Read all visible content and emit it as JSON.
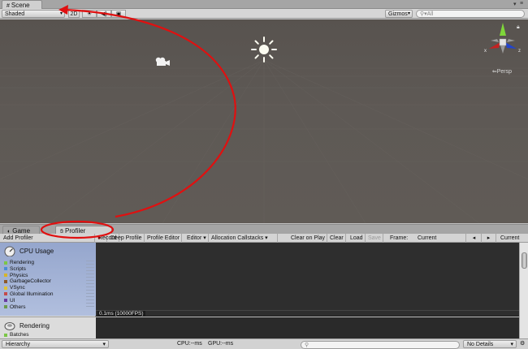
{
  "scene": {
    "tab_label": "Scene",
    "shading_mode": "Shaded",
    "mode_2d_label": "2D",
    "gizmos_label": "Gizmos",
    "search_placeholder": "All",
    "projection_label": "Persp",
    "axis_x": "x",
    "axis_z": "z"
  },
  "bottom_tabs": [
    {
      "label": "Game",
      "icon": "game-controller-icon",
      "active": false
    },
    {
      "label": "Profiler",
      "icon": "profiler-hand-icon",
      "active": true
    }
  ],
  "profiler": {
    "add_profiler_label": "Add Profiler",
    "record_label": "Record",
    "deep_profile_label": "Deep Profile",
    "profile_editor_label": "Profile Editor",
    "editor_label": "Editor",
    "allocation_callstacks_label": "Allocation Callstacks",
    "clear_on_play_label": "Clear on Play",
    "clear_label": "Clear",
    "load_label": "Load",
    "save_label": "Save",
    "frame_label": "Frame:",
    "frame_value": "Current",
    "current_label": "Current",
    "cpu_module": {
      "title": "CPU Usage",
      "legend": [
        {
          "label": "Rendering",
          "color": "#7bc646"
        },
        {
          "label": "Scripts",
          "color": "#4a8bd6"
        },
        {
          "label": "Physics",
          "color": "#d6b52a"
        },
        {
          "label": "GarbageCollector",
          "color": "#8c5a2a"
        },
        {
          "label": "VSync",
          "color": "#e0c43a"
        },
        {
          "label": "Global Illumination",
          "color": "#c44a4a"
        },
        {
          "label": "UI",
          "color": "#6a3aa0"
        },
        {
          "label": "Others",
          "color": "#6a9a4a"
        }
      ],
      "graph_label": "0.1ms (10000FPS)"
    },
    "rendering_module": {
      "title": "Rendering",
      "legend": [
        {
          "label": "Batches",
          "color": "#7bc646"
        }
      ]
    }
  },
  "status_bar": {
    "hierarchy_label": "Hierarchy",
    "cpu_label": "CPU:--ms",
    "gpu_label": "GPU:--ms",
    "details_label": "No Details"
  },
  "colors": {
    "annotation": "#e01010",
    "scene_background": "#5e5955",
    "cpu_header": "#a3b2d5"
  }
}
